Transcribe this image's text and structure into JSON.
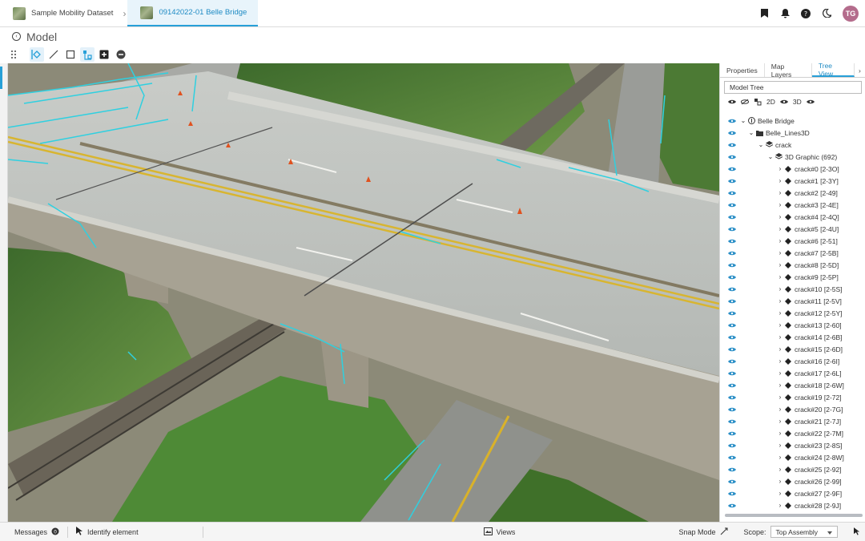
{
  "header": {
    "breadcrumb_root": "Sample Mobility Dataset",
    "breadcrumb_current": "09142022-01 Belle Bridge",
    "user_initials": "TG"
  },
  "page": {
    "title": "Model"
  },
  "panel": {
    "tabs": [
      "Properties",
      "Map Layers",
      "Tree View"
    ],
    "active_tab": "Tree View",
    "model_select": "Model Tree",
    "vis_labels": {
      "d2": "2D",
      "d3": "3D"
    },
    "tree_root": "Belle Bridge",
    "tree_lines": "Belle_Lines3D",
    "tree_crack": "crack",
    "tree_graphic": "3D Graphic (692)",
    "cracks": [
      "crack#0 [2-3O]",
      "crack#1 [2-3Y]",
      "crack#2 [2-49]",
      "crack#3 [2-4E]",
      "crack#4 [2-4Q]",
      "crack#5 [2-4U]",
      "crack#6 [2-51]",
      "crack#7 [2-5B]",
      "crack#8 [2-5D]",
      "crack#9 [2-5P]",
      "crack#10 [2-5S]",
      "crack#11 [2-5V]",
      "crack#12 [2-5Y]",
      "crack#13 [2-60]",
      "crack#14 [2-6B]",
      "crack#15 [2-6D]",
      "crack#16 [2-6I]",
      "crack#17 [2-6L]",
      "crack#18 [2-6W]",
      "crack#19 [2-72]",
      "crack#20 [2-7G]",
      "crack#21 [2-7J]",
      "crack#22 [2-7M]",
      "crack#23 [2-8S]",
      "crack#24 [2-8W]",
      "crack#25 [2-92]",
      "crack#26 [2-99]",
      "crack#27 [2-9F]",
      "crack#28 [2-9J]"
    ]
  },
  "footer": {
    "messages": "Messages",
    "identify": "Identify element",
    "views": "Views",
    "snap_mode": "Snap Mode",
    "scope_label": "Scope:",
    "scope_value": "Top Assembly"
  },
  "colors": {
    "accent": "#27a0d8",
    "eye_icon": "#2b8fc7",
    "crack_overlay": "#2fd0e0"
  }
}
